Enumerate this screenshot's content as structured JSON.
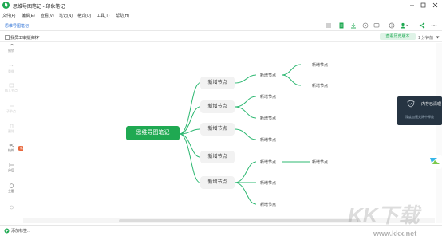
{
  "window": {
    "title": "思维导图笔记 - 印象笔记"
  },
  "menu": {
    "items": [
      "文件(F)",
      "编辑(E)",
      "查看(V)",
      "笔记(N)",
      "格式(O)",
      "工具(T)",
      "帮助(H)"
    ]
  },
  "toolbar": {
    "note_title": "思维导图笔记"
  },
  "subbar": {
    "notebook": "我员工审批资料",
    "version_button": "查看历史版本",
    "zoom": "1 分钟前"
  },
  "rail": {
    "items": [
      "撤销",
      "重做",
      "插入节点",
      "子节点",
      "删除",
      "结构",
      "分层",
      "主题"
    ],
    "badge": "新功"
  },
  "mindmap": {
    "root": "思维导图笔记",
    "branch_label": "新增节点",
    "leaf_label": "新增节点"
  },
  "toast": {
    "title": "内存已清理",
    "body": "深度加速关闭中释放"
  },
  "status": {
    "add_tag": "添加标签..."
  },
  "watermark": {
    "text": "KK下载",
    "url": "www.kkx.net"
  },
  "colors": {
    "accent": "#1fa952",
    "branch_line": "#2eb872"
  }
}
